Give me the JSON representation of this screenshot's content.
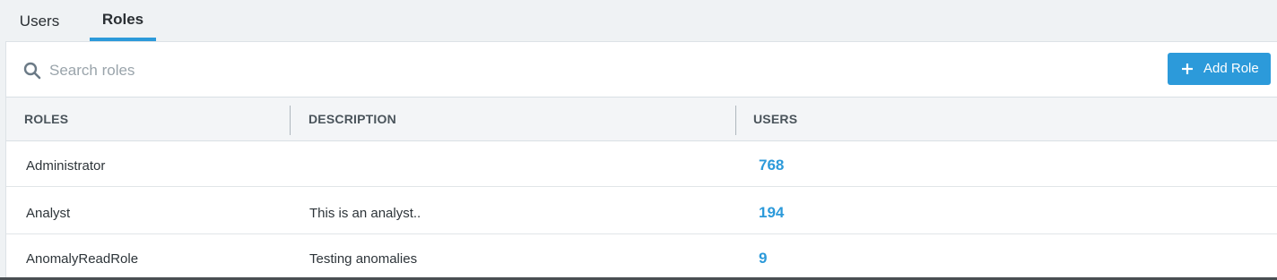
{
  "tabs": [
    {
      "label": "Users",
      "active": false
    },
    {
      "label": "Roles",
      "active": true
    }
  ],
  "search": {
    "placeholder": "Search roles",
    "value": ""
  },
  "toolbar": {
    "add_label": "Add Role"
  },
  "table": {
    "columns": [
      "ROLES",
      "DESCRIPTION",
      "USERS"
    ],
    "rows": [
      {
        "name": "Administrator",
        "description": "",
        "users": "768"
      },
      {
        "name": "Analyst",
        "description": "This is an analyst..",
        "users": "194"
      },
      {
        "name": "AnomalyReadRole",
        "description": "Testing anomalies",
        "users": "9"
      }
    ]
  },
  "colors": {
    "accent": "#2c9ada",
    "background": "#eff2f4",
    "header_bg": "#f3f5f7"
  },
  "icons": {
    "search": "search-icon",
    "add": "plus-icon"
  }
}
